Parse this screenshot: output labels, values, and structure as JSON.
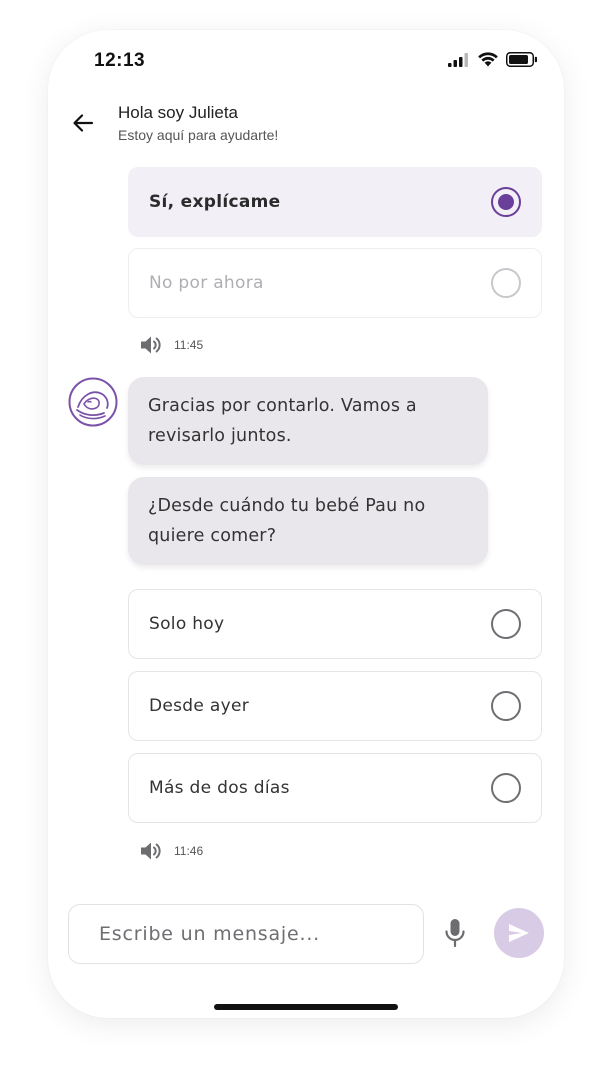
{
  "status_bar": {
    "time": "12:13",
    "icons": [
      "signal-icon",
      "wifi-icon",
      "battery-icon"
    ]
  },
  "header": {
    "title": "Hola soy Julieta",
    "subtitle": "Estoy aquí para ayudarte!",
    "back_icon": "arrow-left-icon"
  },
  "first_question_options": [
    {
      "label": "Sí, explícame",
      "selected": true
    },
    {
      "label": "No por ahora",
      "selected": false
    }
  ],
  "first_timestamp": "11:45",
  "messages": [
    {
      "text": "Gracias por contarlo. Vamos a revisarlo juntos."
    },
    {
      "text": "¿Desde cuándo tu bebé Pau no quiere comer?"
    }
  ],
  "second_question_options": [
    {
      "label": "Solo hoy",
      "selected": false
    },
    {
      "label": "Desde ayer",
      "selected": false
    },
    {
      "label": "Más de dos días",
      "selected": false
    }
  ],
  "second_timestamp": "11:46",
  "composer": {
    "placeholder": "Escribe un mensaje...",
    "mic_icon": "microphone-icon",
    "send_icon": "send-icon"
  },
  "colors": {
    "accent": "#6a3f99",
    "selected_bg": "#f2eff7",
    "bubble_bg": "#e9e7ec",
    "send_bg": "#d8cbe6"
  }
}
